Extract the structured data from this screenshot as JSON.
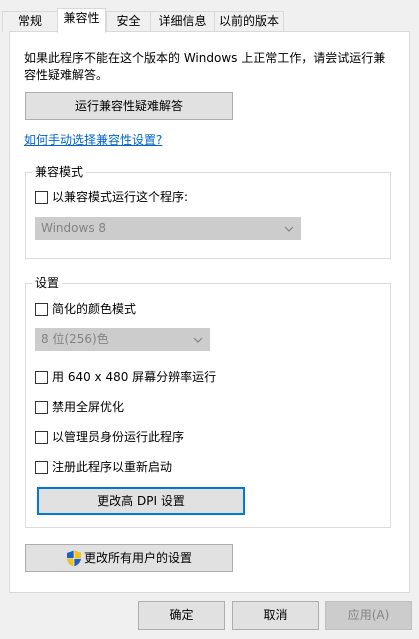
{
  "tabs": [
    "常规",
    "兼容性",
    "安全",
    "详细信息",
    "以前的版本"
  ],
  "active_tab": 1,
  "intro_line1": "如果此程序不能在这个版本的 Windows 上正常工作，请尝试运行兼",
  "intro_line2": "容性疑难解答。",
  "troubleshoot_button": "运行兼容性疑难解答",
  "manual_link": "如何手动选择兼容性设置?",
  "compat_group": {
    "title": "兼容模式",
    "checkbox": "以兼容模式运行这个程序:",
    "select_value": "Windows 8"
  },
  "settings_group": {
    "title": "设置",
    "reduced_color": "简化的颜色模式",
    "color_select_value": "8 位(256)色",
    "res640": "用 640 x 480 屏幕分辨率运行",
    "disable_fullscreen": "禁用全屏优化",
    "run_as_admin": "以管理员身份运行此程序",
    "register_restart": "注册此程序以重新启动",
    "dpi_button": "更改高 DPI 设置"
  },
  "all_users_button": "更改所有用户的设置",
  "footer": {
    "ok": "确定",
    "cancel": "取消",
    "apply": "应用(A)"
  }
}
